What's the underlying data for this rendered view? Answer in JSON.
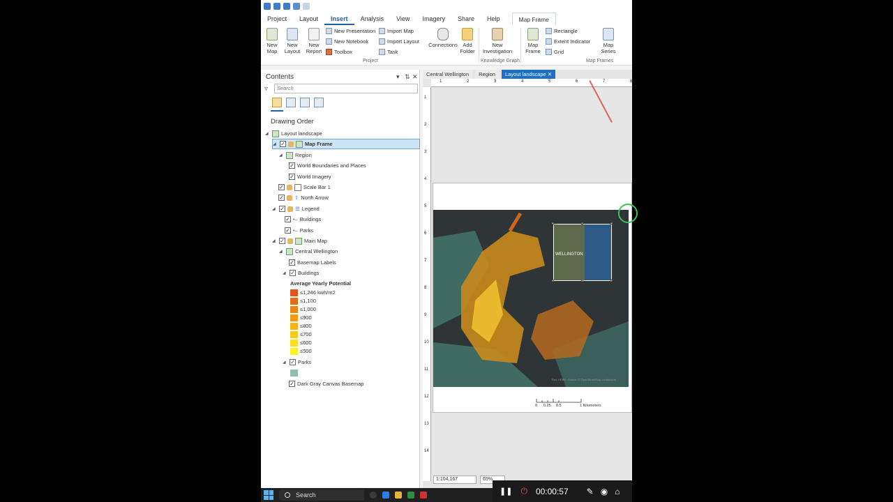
{
  "ribbon": {
    "tabs": [
      "Project",
      "Layout",
      "Insert",
      "Analysis",
      "View",
      "Imagery",
      "Share",
      "Help"
    ],
    "active_tab": "Insert",
    "context_tab": "Map Frame",
    "buttons": {
      "new_map": "New\nMap",
      "new_layout": "New\nLayout",
      "new_report": "New\nReport",
      "connections": "Connections",
      "add_folder": "Add\nFolder",
      "new_investigation": "New\nInvestigation",
      "map_frame": "Map\nFrame",
      "map_series": "Map\nSeries"
    },
    "small_buttons": {
      "new_presentation": "New Presentation",
      "new_notebook": "New Notebook",
      "toolbox": "Toolbox",
      "import_map": "Import Map",
      "import_layout": "Import Layout",
      "task": "Task",
      "rectangle": "Rectangle",
      "extent_indicator": "Extent Indicator",
      "grid": "Grid"
    },
    "groups": {
      "project": "Project",
      "knowledge_graph": "Knowledge Graph",
      "map_frames": "Map Frames"
    }
  },
  "contents": {
    "title": "Contents",
    "search_placeholder": "Search",
    "drawing_order": "Drawing Order",
    "tree": [
      {
        "label": "Layout landscape"
      },
      {
        "label": "Map Frame"
      },
      {
        "label": "Region"
      },
      {
        "label": "World Boundaries and Places"
      },
      {
        "label": "World Imagery"
      },
      {
        "label": "Scale Bar 1"
      },
      {
        "label": "North Arrow"
      },
      {
        "label": "Legend"
      },
      {
        "label": "Buildings"
      },
      {
        "label": "Parks"
      },
      {
        "label": "Main Map"
      },
      {
        "label": "Central Wellington"
      },
      {
        "label": "Basemap Labels"
      },
      {
        "label": "Buildings"
      },
      {
        "label": "Parks"
      },
      {
        "label": "Dark Gray Canvas Basemap"
      }
    ],
    "legend_title": "Average Yearly Potential",
    "legend_items": [
      {
        "label": "≤1,246 kwh/m2",
        "color": "#e2541a"
      },
      {
        "label": "≤1,100",
        "color": "#e86a14"
      },
      {
        "label": "≤1,000",
        "color": "#ee8412"
      },
      {
        "label": "≤900",
        "color": "#f39c12"
      },
      {
        "label": "≤800",
        "color": "#f6b414"
      },
      {
        "label": "≤700",
        "color": "#f8cb18"
      },
      {
        "label": "≤600",
        "color": "#fbe01f"
      },
      {
        "label": "≤500",
        "color": "#fdf227"
      }
    ],
    "parks_color": "#8fbfb1"
  },
  "doc_tabs": [
    "Central Wellington",
    "Region",
    "Layout landscape"
  ],
  "active_doc_tab": "Layout landscape",
  "ruler_numbers_h": [
    "1",
    "2",
    "3",
    "4",
    "5",
    "6",
    "7",
    "8"
  ],
  "ruler_numbers_v": [
    "1",
    "2",
    "3",
    "4",
    "5",
    "6",
    "7",
    "8",
    "9",
    "10",
    "11",
    "12",
    "13",
    "14"
  ],
  "map": {
    "inset_label": "WELLINGTON",
    "attribution": "Esri, HERE, Garmin, © OpenStreetMap contributors",
    "scale_labels": [
      "0",
      "0.25",
      "0.5",
      "1 Kilometers"
    ]
  },
  "status": {
    "scale": "1:104,167",
    "zoom": "65%"
  },
  "taskbar": {
    "search": "Search"
  },
  "recorder": {
    "time": "00:00:57"
  }
}
